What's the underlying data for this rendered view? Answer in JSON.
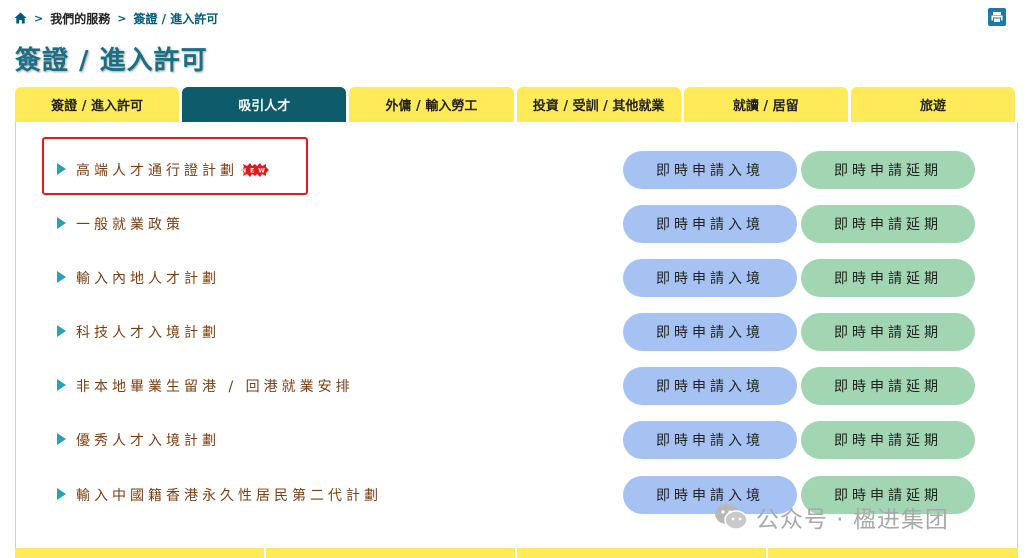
{
  "breadcrumb": {
    "items": [
      "我們的服務",
      "簽證 / 進入許可"
    ],
    "separator": ">"
  },
  "page_title": "簽證 / 進入許可",
  "tabs": [
    {
      "label": "簽證 / 進入許可",
      "active": false
    },
    {
      "label": "吸引人才",
      "active": true
    },
    {
      "label": "外傭 / 輸入勞工",
      "active": false
    },
    {
      "label": "投資 / 受訓 / 其他就業",
      "active": false
    },
    {
      "label": "就讀 / 居留",
      "active": false
    },
    {
      "label": "旅遊",
      "active": false
    }
  ],
  "schemes": [
    {
      "name": "高端人才通行證計劃",
      "badge": "new",
      "entry_label": "即時申請入境",
      "extend_label": "即時申請延期"
    },
    {
      "name": "一般就業政策",
      "entry_label": "即時申請入境",
      "extend_label": "即時申請延期"
    },
    {
      "name": "輸入內地人才計劃",
      "entry_label": "即時申請入境",
      "extend_label": "即時申請延期"
    },
    {
      "name": "科技人才入境計劃",
      "entry_label": "即時申請入境",
      "extend_label": "即時申請延期"
    },
    {
      "name": "非本地畢業生留港 / 回港就業安排",
      "entry_label": "即時申請入境",
      "extend_label": "即時申請延期"
    },
    {
      "name": "優秀人才入境計劃",
      "entry_label": "即時申請入境",
      "extend_label": "即時申請延期"
    },
    {
      "name": "輸入中國籍香港永久性居民第二代計劃",
      "entry_label": "即時申請入境",
      "extend_label": "即時申請延期"
    }
  ],
  "watermark": "公众号 · 楹进集团",
  "icons": {
    "home": "home-icon",
    "corner": "print-icon",
    "new": "new-badge-icon",
    "watermark": "wechat-icon"
  },
  "colors": {
    "tab_yellow": "#ffeb5a",
    "tab_active": "#0d5b6b",
    "title": "#1b6e84",
    "entry_button": "#a5c2f3",
    "extend_button": "#a2d6b3",
    "label_text": "#7a3f14",
    "highlight": "#e01b1b"
  }
}
